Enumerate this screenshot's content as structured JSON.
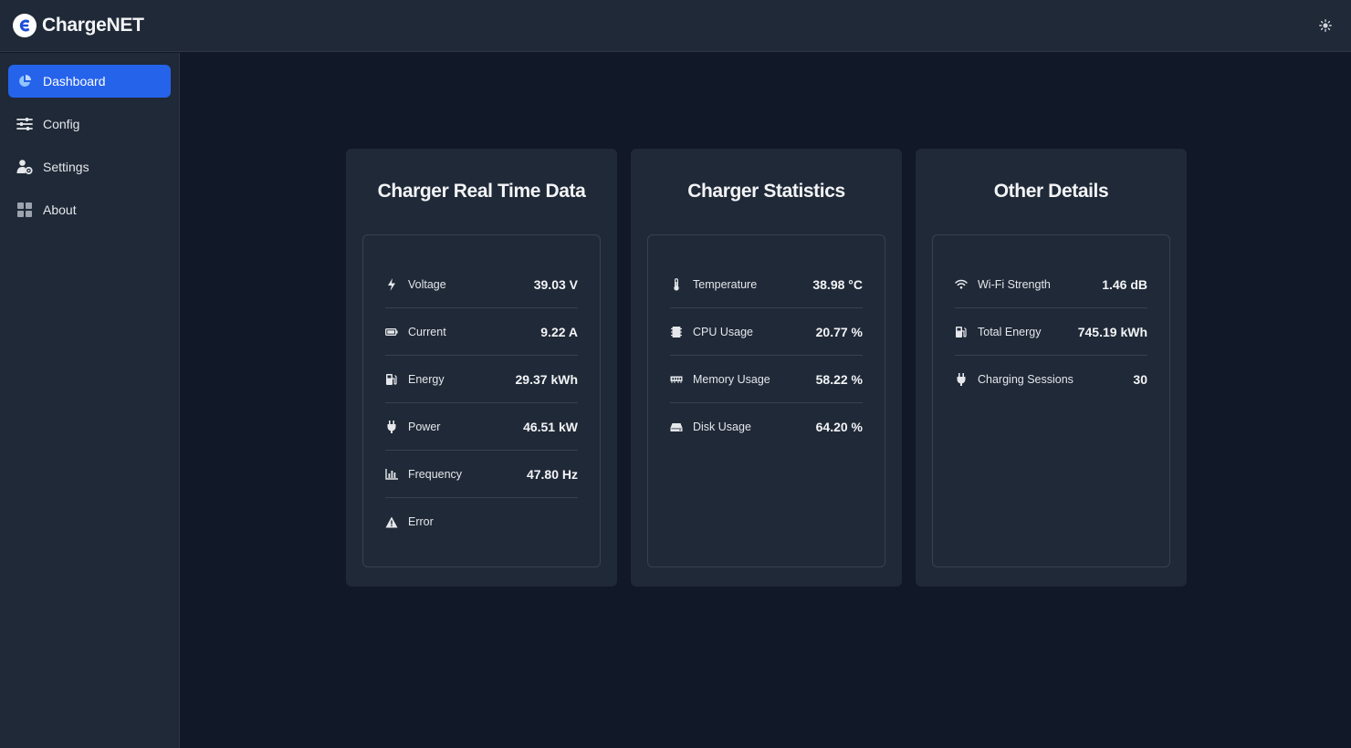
{
  "app": {
    "title": "ChargeNET"
  },
  "sidebar": {
    "items": [
      {
        "label": "Dashboard",
        "icon": "pie-chart-icon",
        "active": true
      },
      {
        "label": "Config",
        "icon": "sliders-icon"
      },
      {
        "label": "Settings",
        "icon": "user-gear-icon"
      },
      {
        "label": "About",
        "icon": "grid-icon"
      }
    ]
  },
  "cards": [
    {
      "title": "Charger Real Time Data",
      "rows": [
        {
          "label": "Voltage",
          "value": "39.03 V",
          "icon": "bolt-icon"
        },
        {
          "label": "Current",
          "value": "9.22 A",
          "icon": "battery-icon"
        },
        {
          "label": "Energy",
          "value": "29.37 kWh",
          "icon": "charging-station-icon"
        },
        {
          "label": "Power",
          "value": "46.51 kW",
          "icon": "plug-icon"
        },
        {
          "label": "Frequency",
          "value": "47.80 Hz",
          "icon": "bar-chart-icon"
        },
        {
          "label": "Error",
          "value": "",
          "icon": "warning-icon"
        }
      ]
    },
    {
      "title": "Charger Statistics",
      "rows": [
        {
          "label": "Temperature",
          "value": "38.98 °C",
          "icon": "thermometer-icon"
        },
        {
          "label": "CPU Usage",
          "value": "20.77 %",
          "icon": "cpu-icon"
        },
        {
          "label": "Memory Usage",
          "value": "58.22 %",
          "icon": "memory-icon"
        },
        {
          "label": "Disk Usage",
          "value": "64.20 %",
          "icon": "hard-drive-icon"
        }
      ]
    },
    {
      "title": "Other Details",
      "rows": [
        {
          "label": "Wi-Fi Strength",
          "value": "1.46 dB",
          "icon": "wifi-icon"
        },
        {
          "label": "Total Energy",
          "value": "745.19 kWh",
          "icon": "charging-station-icon"
        },
        {
          "label": "Charging Sessions",
          "value": "30",
          "icon": "plug-icon"
        }
      ]
    }
  ],
  "colors": {
    "background": "#111827",
    "panel": "#1f2937",
    "accent": "#2563eb",
    "border": "#374151"
  }
}
